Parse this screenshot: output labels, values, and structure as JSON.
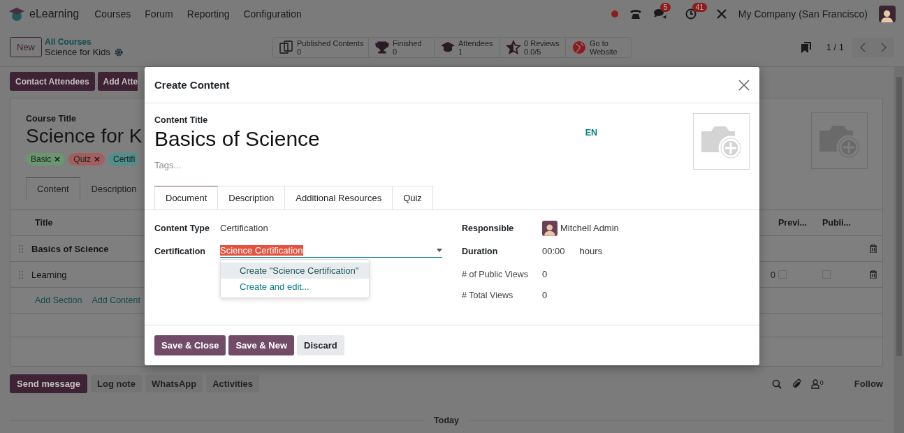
{
  "navbar": {
    "app_name": "eLearning",
    "menu": [
      "Courses",
      "Forum",
      "Reporting",
      "Configuration"
    ],
    "messages_badge": "5",
    "activities_badge": "41",
    "company": "My Company (San Francisco)"
  },
  "control_panel": {
    "new_button": "New",
    "breadcrumb_parent": "All Courses",
    "breadcrumb_current": "Science for Kids",
    "stat_buttons": [
      {
        "kind": "contents",
        "label": "Published Contents",
        "value": "0"
      },
      {
        "kind": "trophy",
        "label": "Finished",
        "value": "0"
      },
      {
        "kind": "attendees",
        "label": "Attendees",
        "value": "1"
      },
      {
        "kind": "reviews",
        "label": "0 Reviews",
        "value": "0.0/5"
      },
      {
        "kind": "website",
        "label": "Go to Website"
      }
    ],
    "pager": "1 / 1"
  },
  "header_buttons": [
    "Contact Attendees",
    "Add Atte"
  ],
  "course": {
    "title_label": "Course Title",
    "title": "Science for K",
    "tags": [
      {
        "label": "Basic",
        "color": "#6a9670"
      },
      {
        "label": "Quiz",
        "color": "#a35e5e"
      },
      {
        "label": "Certifi",
        "color": "#4f8f8d"
      }
    ],
    "tabs": [
      {
        "label": "Content",
        "selected": true
      },
      {
        "label": "Description",
        "selected": false
      }
    ],
    "columns": [
      "Title",
      "Previ...",
      "Publi..."
    ],
    "rows": [
      {
        "kind": "section",
        "title": "Basics of Science"
      },
      {
        "kind": "content",
        "title": "Learning",
        "column_2": "0",
        "preview_checked": false,
        "published_checked": false
      }
    ],
    "add_links": [
      "Add Section",
      "Add Content"
    ]
  },
  "chatter": {
    "buttons": [
      {
        "label": "Send message",
        "kind": "primary"
      },
      {
        "label": "Log note",
        "kind": "secondary"
      },
      {
        "label": "WhatsApp",
        "kind": "secondary"
      },
      {
        "label": "Activities",
        "kind": "secondary"
      }
    ],
    "followers_count": "0",
    "follow": "Follow",
    "date_separator": "Today"
  },
  "dialog": {
    "title": "Create Content",
    "content_title_label": "Content Title",
    "content_title": "Basics of Science",
    "language": "EN",
    "tags_placeholder": "Tags...",
    "tabs": [
      {
        "label": "Document",
        "selected": true
      },
      {
        "label": "Description",
        "selected": false
      },
      {
        "label": "Additional Resources",
        "selected": false
      },
      {
        "label": "Quiz",
        "selected": false
      }
    ],
    "fields_left": [
      {
        "kind": "text",
        "label": "Content Type",
        "value": "Certification"
      },
      {
        "kind": "dropdown",
        "label": "Certification",
        "value": "Science Certification"
      }
    ],
    "dropdown_options": [
      {
        "label": "Create \"Science Certification\"",
        "selected": true
      },
      {
        "label": "Create and edit...",
        "selected": false
      }
    ],
    "fields_right": [
      {
        "kind": "user",
        "label": "Responsible",
        "value": "Mitchell Admin"
      },
      {
        "kind": "duration",
        "label": "Duration",
        "value": "00:00",
        "unit": "hours"
      },
      {
        "kind": "text",
        "label": "# of Public Views",
        "value": "0"
      },
      {
        "kind": "text",
        "label": "# Total Views",
        "value": "0"
      }
    ],
    "buttons": [
      {
        "label": "Save & Close",
        "kind": "primary"
      },
      {
        "label": "Save & New",
        "kind": "primary"
      },
      {
        "label": "Discard",
        "kind": "secondary"
      }
    ]
  }
}
